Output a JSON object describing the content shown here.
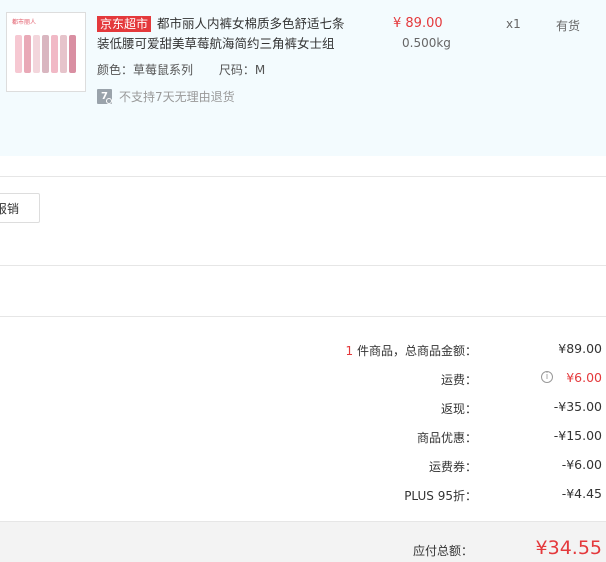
{
  "product": {
    "badge": "京东超市",
    "title": "都市丽人内裤女棉质多色舒适七条装低腰可爱甜美草莓航海简约三角裤女士组",
    "color_label": "颜色：草莓鼠系列",
    "size_label": "尺码：M",
    "return_icon": "7",
    "return_text": "不支持7天无理由退货",
    "price": "¥ 89.00",
    "weight": "0.500kg",
    "quantity": "x1",
    "stock": "有货",
    "thumb_brand": "都市丽人"
  },
  "actions": {
    "reimburse_label": "报销"
  },
  "summary": {
    "item_count": "1",
    "item_count_suffix": " 件商品，总商品金额：",
    "total_goods_value": "¥89.00",
    "shipping_label": "运费：",
    "shipping_value": "¥6.00",
    "cashback_label": "返现：",
    "cashback_value": "-¥35.00",
    "discount_label": "商品优惠：",
    "discount_value": "-¥15.00",
    "shipping_coupon_label": "运费券：",
    "shipping_coupon_value": "-¥6.00",
    "plus_label": "PLUS 95折：",
    "plus_value": "-¥4.45",
    "payable_label": "应付总额：",
    "payable_value": "¥34.55"
  },
  "icons": {
    "info": "i"
  },
  "colors": {
    "accent": "#e4393c",
    "panel_bg": "#f3fbfe"
  }
}
